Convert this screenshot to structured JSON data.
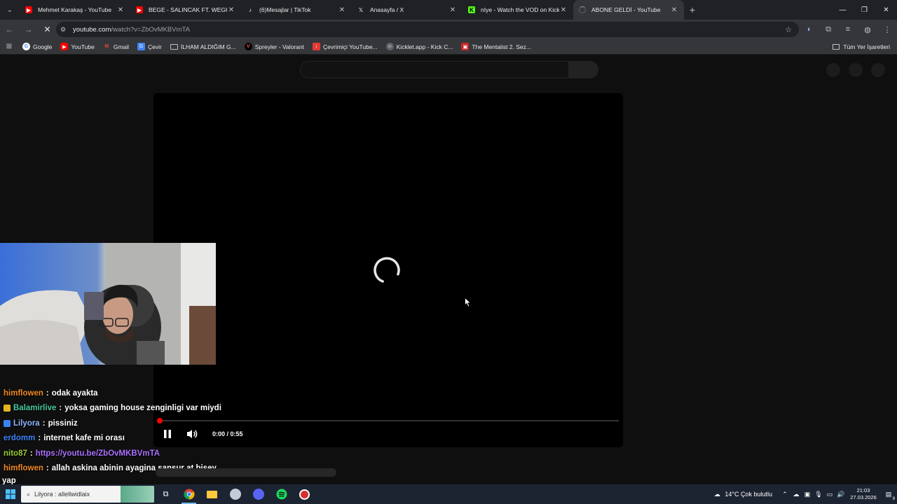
{
  "browser": {
    "tabs": [
      {
        "title": "Mehmet Karakaş - YouTube",
        "icon": "youtube-icon",
        "active": false
      },
      {
        "title": "BEGE - SALINCAK FT. WEGH, O",
        "icon": "youtube-icon",
        "active": false
      },
      {
        "title": "(6)Mesajlar | TikTok",
        "icon": "tiktok-icon",
        "active": false
      },
      {
        "title": "Anasayfa / X",
        "icon": "x-icon",
        "active": false
      },
      {
        "title": "nIye - Watch the VOD on Kick",
        "icon": "kick-icon",
        "active": false
      },
      {
        "title": "ABONE GELDİ - YouTube",
        "icon": "loading-icon",
        "active": true
      }
    ],
    "url_host": "youtube.com",
    "url_path": "/watch?v=ZbOvMKBVmTA",
    "bookmarks": [
      {
        "label": "Google",
        "icon": "google-icon",
        "color": "#4285f4"
      },
      {
        "label": "YouTube",
        "icon": "youtube-icon",
        "color": "#ff0000"
      },
      {
        "label": "Gmail",
        "icon": "gmail-icon",
        "color": "#ea4335"
      },
      {
        "label": "Çevir",
        "icon": "translate-icon",
        "color": "#4285f4"
      },
      {
        "label": "İLHAM ALDIĞIM G...",
        "icon": "folder-icon",
        "color": "#bdc1c6"
      },
      {
        "label": "Spreyler - Valorant",
        "icon": "valorant-icon",
        "color": "#ff4655"
      },
      {
        "label": "Çevrimiçi YouTube...",
        "icon": "converter-icon",
        "color": "#e53935"
      },
      {
        "label": "Kicklet.app - Kick C...",
        "icon": "kicklet-icon",
        "color": "#9e9e9e"
      },
      {
        "label": "The Mentalist 2. Sez...",
        "icon": "tv-icon",
        "color": "#c62828"
      }
    ],
    "all_bookmarks": "Tüm Yer İşaretleri"
  },
  "player": {
    "time": "0:00 / 0:55",
    "progress": 0
  },
  "chat": [
    {
      "user": "himflowen",
      "color": "#f08a24",
      "message": "odak ayakta",
      "badge": null,
      "link": false
    },
    {
      "user": "Balamirlive",
      "color": "#46c8a0",
      "message": "yoksa gaming house zenginligi var miydi",
      "badge": "#e6b422",
      "link": false
    },
    {
      "user": "Lilyora",
      "color": "#8fb6ff",
      "message": "pissiniz",
      "badge": "#3b82f6",
      "link": false
    },
    {
      "user": "erdomm",
      "color": "#3b82f6",
      "message": "internet kafe mi orası",
      "badge": null,
      "link": false
    },
    {
      "user": "nito87",
      "color": "#9acd32",
      "message": "https://youtu.be/ZbOvMKBVmTA",
      "badge": null,
      "link": true
    },
    {
      "user": "himflowen",
      "color": "#f08a24",
      "message": "allah askina abinin ayagina sansur at bisey",
      "badge": null,
      "link": false
    }
  ],
  "chat_wrap": "yap",
  "taskbar": {
    "search_text": "Lilyora : allellwidlaix",
    "weather": "14°C  Çok bulutlu",
    "time": "21:03",
    "date": "27.03.2026",
    "notifications": "9"
  }
}
